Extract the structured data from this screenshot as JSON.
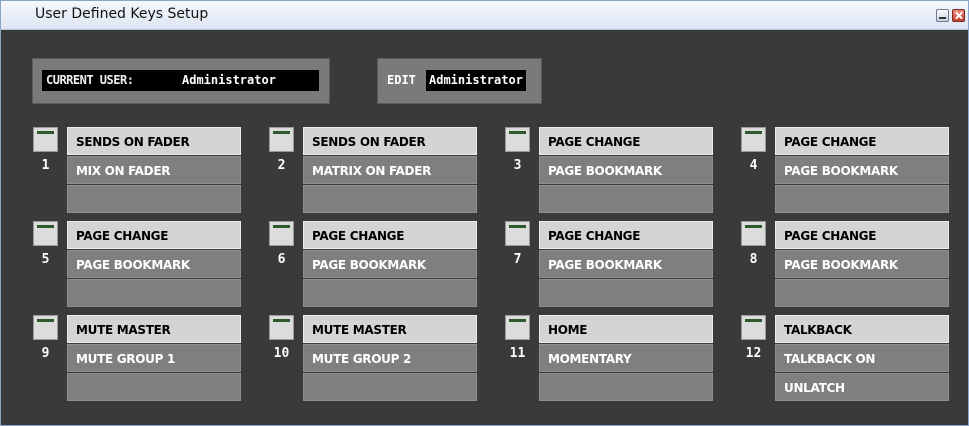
{
  "window": {
    "title": "User Defined Keys Setup"
  },
  "current_user": {
    "label": "CURRENT USER:",
    "value": "Administrator"
  },
  "edit": {
    "label": "EDIT",
    "value": "Administrator"
  },
  "keys": [
    {
      "number": "1",
      "function": "SENDS ON FADER",
      "param1": "MIX ON FADER",
      "param2": ""
    },
    {
      "number": "2",
      "function": "SENDS ON FADER",
      "param1": "MATRIX ON FADER",
      "param2": ""
    },
    {
      "number": "3",
      "function": "PAGE CHANGE",
      "param1": "PAGE BOOKMARK",
      "param2": ""
    },
    {
      "number": "4",
      "function": "PAGE CHANGE",
      "param1": "PAGE BOOKMARK",
      "param2": ""
    },
    {
      "number": "5",
      "function": "PAGE CHANGE",
      "param1": "PAGE BOOKMARK",
      "param2": ""
    },
    {
      "number": "6",
      "function": "PAGE CHANGE",
      "param1": "PAGE BOOKMARK",
      "param2": ""
    },
    {
      "number": "7",
      "function": "PAGE CHANGE",
      "param1": "PAGE BOOKMARK",
      "param2": ""
    },
    {
      "number": "8",
      "function": "PAGE CHANGE",
      "param1": "PAGE BOOKMARK",
      "param2": ""
    },
    {
      "number": "9",
      "function": "MUTE MASTER",
      "param1": "MUTE GROUP 1",
      "param2": ""
    },
    {
      "number": "10",
      "function": "MUTE MASTER",
      "param1": "MUTE GROUP 2",
      "param2": ""
    },
    {
      "number": "11",
      "function": "HOME",
      "param1": "MOMENTARY",
      "param2": ""
    },
    {
      "number": "12",
      "function": "TALKBACK",
      "param1": "TALKBACK ON",
      "param2": "UNLATCH"
    }
  ]
}
